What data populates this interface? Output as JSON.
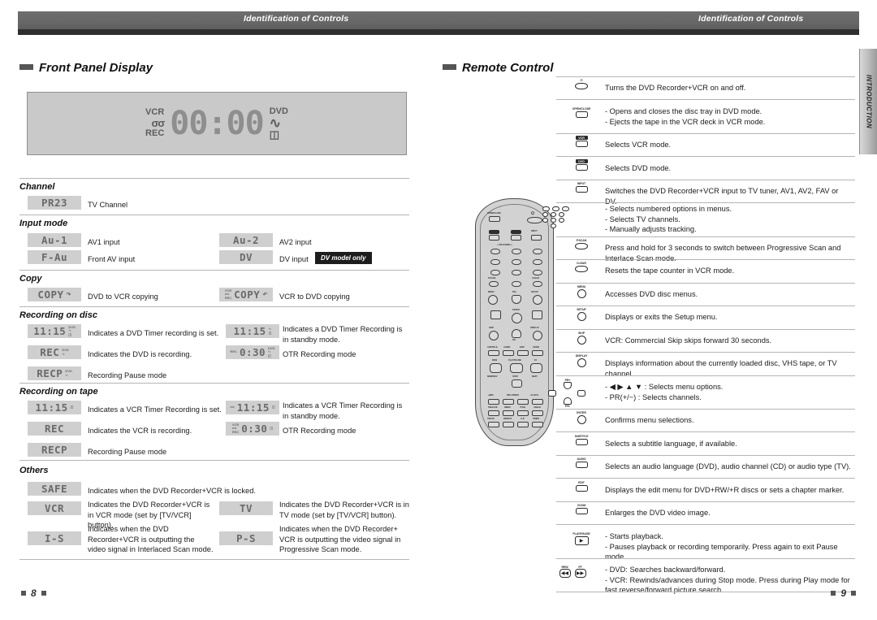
{
  "header": {
    "title_left": "Identification of Controls",
    "title_right": "Identification of Controls",
    "side_tab": "INTRODUCTION"
  },
  "left_page": {
    "section_title": "Front Panel Display",
    "page_number": "8",
    "front_panel": {
      "label_vcr": "VCR",
      "label_tape_icon": "σσ",
      "label_rec": "REC",
      "label_dvd": "DVD",
      "digits": "00:00",
      "disc_icon": "disc",
      "square_icon": "square"
    },
    "groups": [
      {
        "title": "Channel",
        "rows": [
          {
            "chip": "PR23",
            "desc": "TV Channel"
          }
        ]
      },
      {
        "title": "Input mode",
        "rows": [
          {
            "chip": "Au-1",
            "desc": "AV1 input",
            "chip2": "Au-2",
            "desc2": "AV2 input"
          },
          {
            "chip": "F-Au",
            "desc": "Front AV input",
            "chip2": "DV",
            "desc2": "DV input",
            "badge": "DV model only"
          }
        ]
      },
      {
        "title": "Copy",
        "rows": [
          {
            "chip": "COPY",
            "chip_sym": "↷",
            "desc": "DVD to VCR copying",
            "chip2": "COPY",
            "chip2_micro_l": [
              "VCR",
              "σσ",
              "REC"
            ],
            "chip2_sym": "↶",
            "chip2_micro_r": [
              "DVD",
              ""
            ],
            "desc2": "VCR to DVD copying"
          }
        ]
      },
      {
        "title": "Recording on disc",
        "rows": [
          {
            "chip": "11:15",
            "chip_micro_r": [
              "DVD",
              "↻",
              "□"
            ],
            "desc": "Indicates a DVD Timer recording is set.",
            "chip2": "11:15",
            "chip2_micro_r": [
              "↻",
              "□"
            ],
            "desc2": "Indicates a DVD Timer Recording is in standby mode."
          },
          {
            "chip": "REC",
            "chip_micro_r": [
              "DVD",
              "↻"
            ],
            "desc": "Indicates the DVD is recording.",
            "chip2": "0:30",
            "chip2_micro_l": [
              "REC"
            ],
            "chip2_micro_r": [
              "DVD",
              "↻",
              "□"
            ],
            "desc2": "OTR Recording mode"
          },
          {
            "chip": "RECP",
            "chip_micro_r": [
              "DVD",
              "↻"
            ],
            "desc": "Recording Pause mode"
          }
        ]
      },
      {
        "title": "Recording on tape",
        "rows": [
          {
            "chip": "11:15",
            "chip_micro_r": [
              "□"
            ],
            "desc": "Indicates a VCR Timer Recording is set.",
            "chip2": "11:15",
            "chip2_micro_l": [
              "σσ"
            ],
            "chip2_micro_r": [
              "□"
            ],
            "desc2": "Indicates a VCR Timer Recording is in standby mode."
          },
          {
            "chip": "REC",
            "desc": "Indicates the VCR is recording.",
            "chip2": "0:30",
            "chip2_micro_l": [
              "VCR",
              "σσ",
              "REC"
            ],
            "chip2_micro_r": [
              "□"
            ],
            "desc2": "OTR Recording mode"
          },
          {
            "chip": "RECP",
            "desc": "Recording Pause mode"
          }
        ]
      },
      {
        "title": "Others",
        "rows": [
          {
            "chip": "SAFE",
            "desc": "Indicates when the DVD Recorder+VCR is locked."
          },
          {
            "chip": "VCR",
            "desc": "Indicates the DVD Recorder+VCR is in VCR mode (set by [TV/VCR] button).",
            "chip2": "TV",
            "desc2": "Indicates the DVD Recorder+VCR is in TV mode (set by [TV/VCR] button)."
          },
          {
            "chip": "I-S",
            "desc": "Indicates when the DVD Recorder+VCR is outputting the video signal in Interlaced Scan mode.",
            "chip2": "P-S",
            "desc2": "Indicates when the DVD Recorder+ VCR is outputting the video signal in Progressive Scan mode."
          }
        ]
      }
    ]
  },
  "right_page": {
    "section_title": "Remote Control",
    "page_number": "9",
    "remote_buttons": [
      "OPEN/CLOSE",
      "POWER",
      "VCR",
      "DVD",
      "INPUT",
      "1",
      "2",
      "3",
      "4",
      "5",
      "6",
      "7",
      "8",
      "9",
      "0",
      "P.SCAN",
      "CLEAR",
      "MENU",
      "PR+",
      "SETUP",
      "ENTER",
      "SKIP",
      "PR-",
      "DISPLAY",
      "SUBTITLE",
      "AUDIO",
      "EDIT",
      "ZOOM",
      "REW",
      "PLAY/PAUSE",
      "FF",
      "MIN/PREV",
      "STOP",
      "NEXT",
      "REC",
      "REC.SPEED",
      "CLOCK",
      "FINALIZE",
      "INDEX",
      "TITLE",
      "ANGLE",
      "TRACKING",
      "REPEAT",
      "A-B",
      "TIMER"
    ],
    "rows": [
      {
        "icon": "power-button",
        "icon_label": "⏻",
        "icon_shape": "ellipse",
        "lines": [
          "Turns the DVD Recorder+VCR on and off."
        ]
      },
      {
        "icon": "open-close-button",
        "icon_label": "OPEN/CLOSE",
        "icon_shape": "rect",
        "lines": [
          "- Opens and closes the disc tray in DVD mode.",
          "- Ejects the tape in the VCR deck in VCR mode."
        ]
      },
      {
        "icon": "vcr-button",
        "icon_label": "VCR",
        "icon_shape": "rect",
        "icon_key": true,
        "lines": [
          "Selects VCR mode."
        ]
      },
      {
        "icon": "dvd-button",
        "icon_label": "DVD",
        "icon_shape": "rect",
        "icon_key": true,
        "lines": [
          "Selects DVD mode."
        ]
      },
      {
        "icon": "input-button",
        "icon_label": "INPUT",
        "icon_shape": "rect",
        "lines": [
          "Switches the DVD Recorder+VCR input to TV tuner, AV1, AV2, FAV or DV."
        ]
      },
      {
        "icon": "number-buttons",
        "icon_label": "numpad",
        "icon_shape": "numpad",
        "lines": [
          "- Selects numbered options in menus.",
          "- Selects TV channels.",
          "- Manually adjusts tracking."
        ]
      },
      {
        "icon": "p-scan-button",
        "icon_label": "P.SCAN",
        "icon_shape": "ellipse",
        "lines": [
          "Press and hold for 3 seconds to switch between Progressive Scan and Interlace Scan mode."
        ]
      },
      {
        "icon": "clear-button",
        "icon_label": "CLEAR",
        "icon_shape": "ellipse",
        "lines": [
          "Resets the tape counter in VCR mode."
        ]
      },
      {
        "icon": "menu-button",
        "icon_label": "MENU",
        "icon_shape": "circle",
        "lines": [
          "Accesses DVD disc menus."
        ]
      },
      {
        "icon": "setup-button",
        "icon_label": "SETUP",
        "icon_shape": "circle",
        "lines": [
          "Displays or exits the Setup menu."
        ]
      },
      {
        "icon": "skip-button",
        "icon_label": "SKIP",
        "icon_shape": "circle",
        "lines": [
          "VCR: Commercial Skip skips forward 30 seconds."
        ]
      },
      {
        "icon": "display-button",
        "icon_label": "DISPLAY",
        "icon_shape": "circle",
        "lines": [
          "Displays information about the currently loaded disc, VHS tape, or TV channel."
        ]
      },
      {
        "icon": "direction-pad",
        "icon_label": "arrows",
        "icon_shape": "dpad",
        "lines": [
          "- ◀ ▶ ▲ ▼ : Selects menu options.",
          "- PR(+/−) : Selects channels."
        ]
      },
      {
        "icon": "enter-button",
        "icon_label": "ENTER",
        "icon_shape": "circle",
        "lines": [
          "Confirms menu selections."
        ]
      },
      {
        "icon": "subtitle-button",
        "icon_label": "SUBTITLE",
        "icon_shape": "rect",
        "lines": [
          "Selects a subtitle language, if available."
        ]
      },
      {
        "icon": "audio-button",
        "icon_label": "AUDIO",
        "icon_shape": "rect",
        "lines": [
          "Selects an audio language (DVD), audio channel (CD) or audio type (TV)."
        ]
      },
      {
        "icon": "edit-button",
        "icon_label": "EDIT",
        "icon_shape": "rect",
        "lines": [
          "Displays the edit menu for DVD+RW/+R discs or sets a chapter marker."
        ]
      },
      {
        "icon": "zoom-button",
        "icon_label": "ZOOM",
        "icon_shape": "rect",
        "lines": [
          "Enlarges the DVD video image."
        ]
      },
      {
        "icon": "play-pause-button",
        "icon_label": "PLAY/PAUSE",
        "icon_shape": "play",
        "lines": [
          "- Starts playback.",
          "- Pauses playback or recording temporarily. Press again to exit Pause mode."
        ]
      },
      {
        "icon": "search-buttons",
        "icon_label": "REW FF",
        "icon_shape": "search",
        "lines": [
          "- DVD: Searches backward/forward.",
          "- VCR: Rewinds/advances during Stop mode. Press during Play mode for fast reverse/forward picture search."
        ]
      }
    ]
  }
}
